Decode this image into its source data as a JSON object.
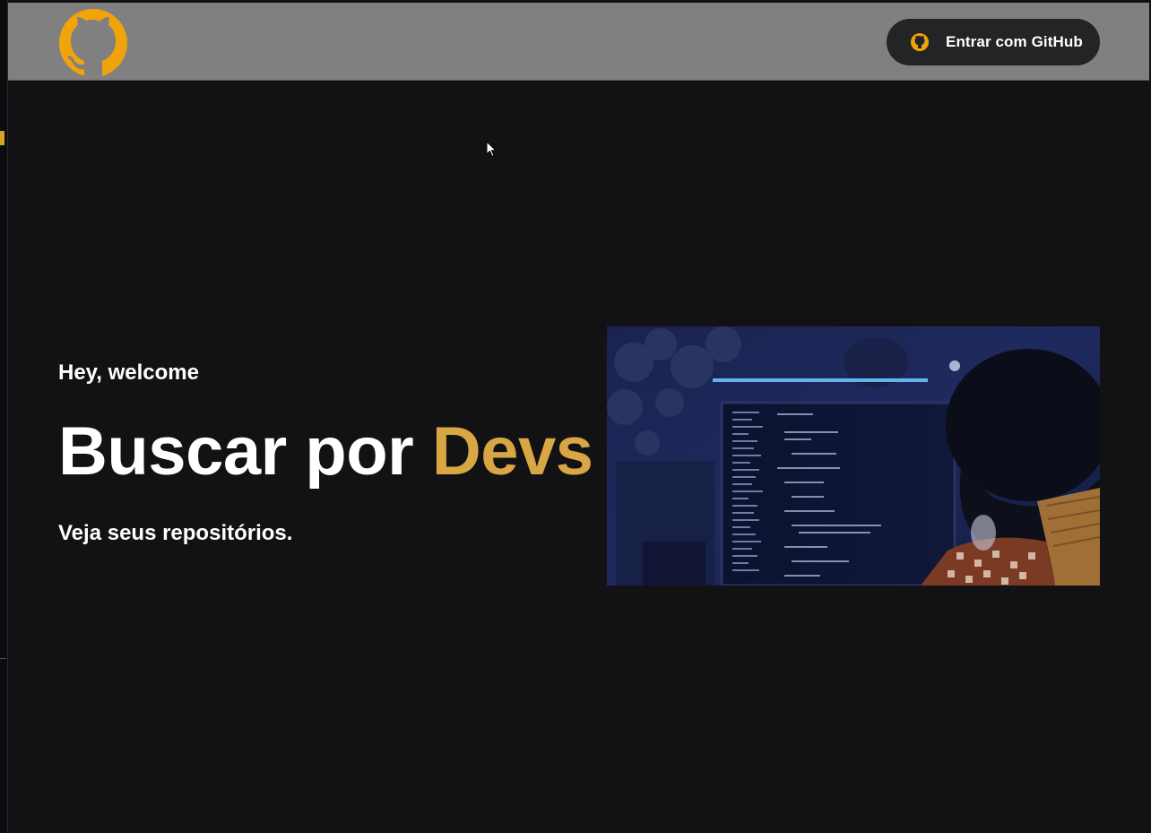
{
  "header": {
    "logo_icon": "github-octocat-icon",
    "login_button": {
      "icon": "github-icon",
      "label": "Entrar com GitHub"
    }
  },
  "hero": {
    "greeting": "Hey, welcome",
    "headline_prefix": "Buscar por ",
    "headline_accent": "Devs",
    "subtitle": "Veja seus repositórios.",
    "image_description": "developer-coding-photo"
  },
  "colors": {
    "background": "#121214",
    "header_bg": "#808080",
    "accent": "#d8a743",
    "logo": "#f0a30a",
    "button_bg": "#222426"
  }
}
